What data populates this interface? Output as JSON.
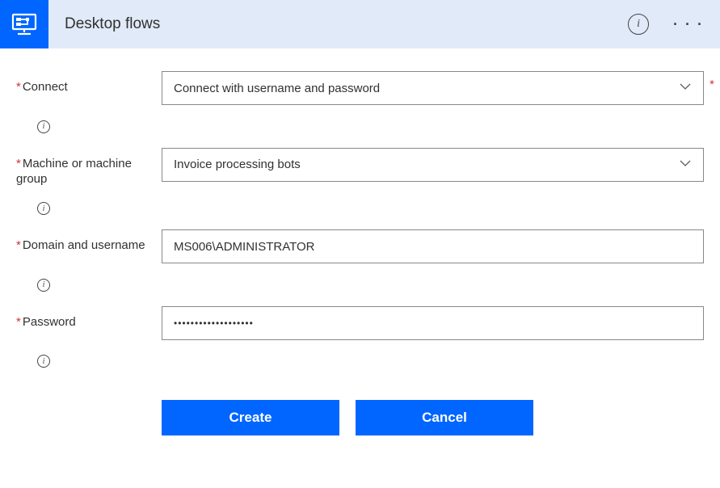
{
  "header": {
    "title": "Desktop flows"
  },
  "form": {
    "connect": {
      "label": "Connect",
      "value": "Connect with username and password"
    },
    "machine": {
      "label": "Machine or machine group",
      "value": "Invoice processing bots"
    },
    "domain": {
      "label": "Domain and username",
      "value": "MS006\\ADMINISTRATOR"
    },
    "password": {
      "label": "Password",
      "masked": "•••••••••••••••••••"
    }
  },
  "buttons": {
    "create": "Create",
    "cancel": "Cancel"
  }
}
